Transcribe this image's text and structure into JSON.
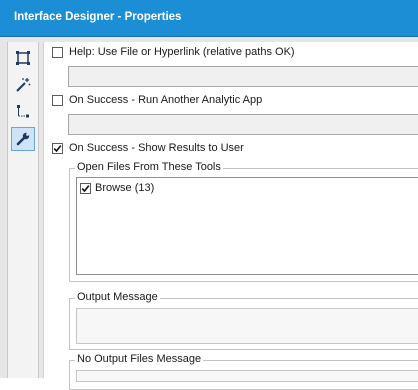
{
  "window": {
    "title": "Interface Designer - Properties"
  },
  "toolbar": {
    "buttons": [
      {
        "icon": "layout-select-icon",
        "active": false
      },
      {
        "icon": "magic-wand-icon",
        "active": false
      },
      {
        "icon": "tree-connector-icon",
        "active": false
      },
      {
        "icon": "wrench-icon",
        "active": true
      }
    ]
  },
  "properties": {
    "help": {
      "label": "Help: Use File or Hyperlink (relative paths OK)",
      "checked": false,
      "value": ""
    },
    "on_success_run": {
      "label": "On Success - Run Another Analytic App",
      "checked": false,
      "value": ""
    },
    "on_success_show": {
      "label": "On Success - Show Results to User",
      "checked": true
    },
    "open_files": {
      "legend": "Open Files From These Tools",
      "items": [
        {
          "label": "Browse (13)",
          "checked": true
        }
      ]
    },
    "output_message": {
      "legend": "Output Message",
      "value": ""
    },
    "no_output_message": {
      "legend": "No Output Files Message",
      "value": ""
    }
  }
}
